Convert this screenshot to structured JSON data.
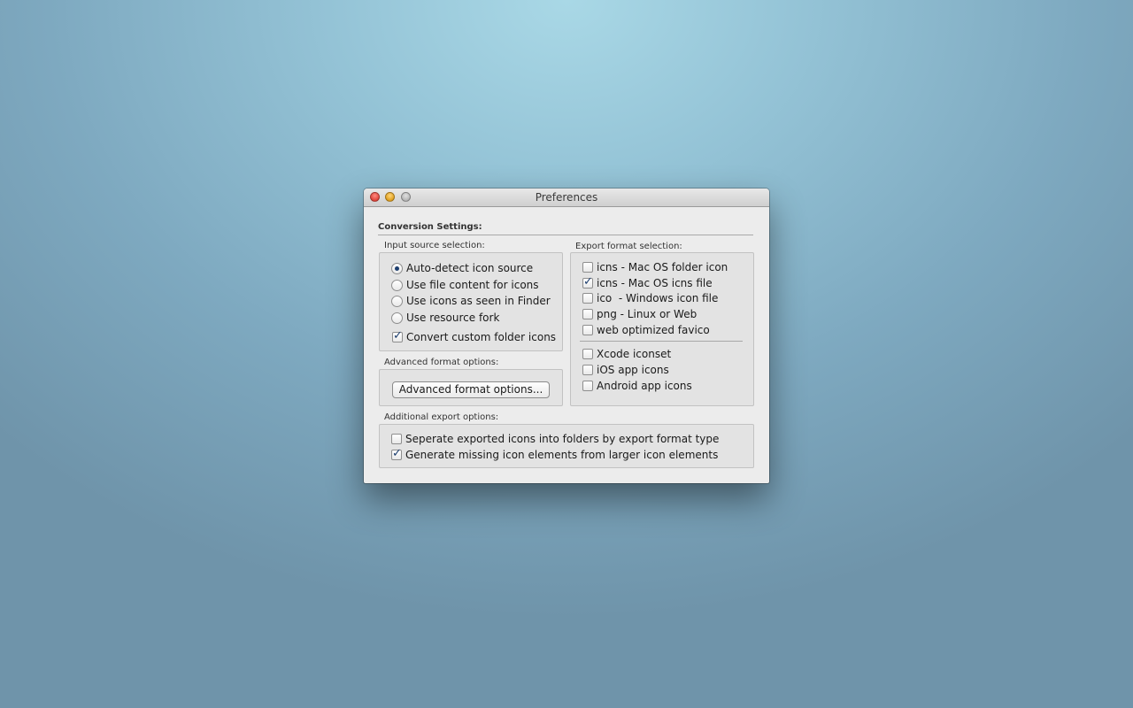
{
  "window": {
    "title": "Preferences"
  },
  "conversion_settings": {
    "title": "Conversion Settings:"
  },
  "input_source": {
    "label": "Input source selection:",
    "options": [
      {
        "label": "Auto-detect icon source",
        "selected": true
      },
      {
        "label": "Use file content for icons",
        "selected": false
      },
      {
        "label": "Use icons as seen in Finder",
        "selected": false
      },
      {
        "label": "Use resource fork",
        "selected": false
      }
    ],
    "convert_custom": {
      "label": "Convert custom folder icons",
      "checked": true
    }
  },
  "advanced": {
    "label": "Advanced format options:",
    "button_label": "Advanced format options..."
  },
  "export_format": {
    "label": "Export format selection:",
    "items": [
      {
        "label": "icns - Mac OS folder icon",
        "checked": false
      },
      {
        "label": "icns - Mac OS icns file",
        "checked": true
      },
      {
        "label": "ico  - Windows icon file",
        "checked": false
      },
      {
        "label": "png - Linux or Web",
        "checked": false
      },
      {
        "label": "web optimized favico",
        "checked": false
      },
      {
        "label": "Xcode iconset",
        "checked": false
      },
      {
        "label": "iOS app icons",
        "checked": false
      },
      {
        "label": "Android app icons",
        "checked": false
      }
    ]
  },
  "additional": {
    "label": "Additional export options:",
    "items": [
      {
        "label": "Seperate exported icons into folders by export format type",
        "checked": false
      },
      {
        "label": "Generate missing icon elements from larger icon elements",
        "checked": true
      }
    ]
  }
}
